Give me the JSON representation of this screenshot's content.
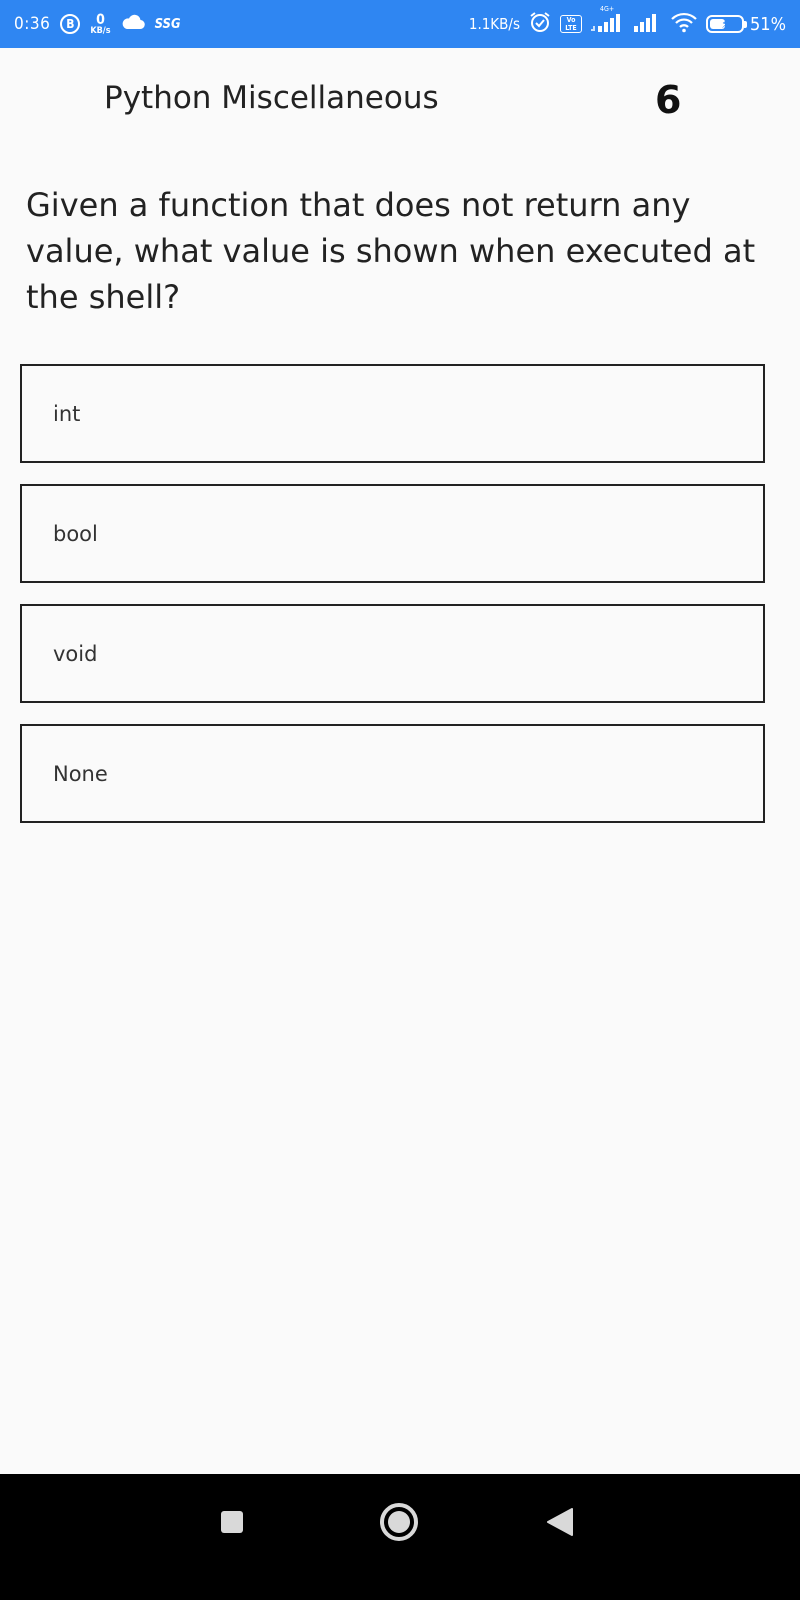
{
  "status_bar": {
    "time": "0:36",
    "b_badge": "B",
    "net_kbs_value": "0",
    "net_kbs_unit": "KB/s",
    "carrier_tag": "SSG",
    "speed": "1.1KB/s",
    "volte_top": "Vo",
    "volte_bottom": "LTE",
    "network_type": "4G+",
    "battery_percent": "51%",
    "battery_level": 0.51,
    "icons": [
      "cloud-icon",
      "alarm-icon",
      "signal-icon",
      "signal-icon",
      "wifi-icon",
      "battery-charging-icon"
    ]
  },
  "header": {
    "title": "Python Miscellaneous",
    "question_number": "6"
  },
  "question": {
    "text": "Given a function that does not return any value, what value is shown when executed at the shell?"
  },
  "options": [
    {
      "label": "int"
    },
    {
      "label": "bool"
    },
    {
      "label": "void"
    },
    {
      "label": "None"
    }
  ],
  "nav_bar": {
    "icons": [
      "recents-icon",
      "home-icon",
      "back-icon"
    ]
  },
  "colors": {
    "status_bar": "#2f86f2",
    "background": "#fafafa",
    "option_border": "#222222",
    "nav_bar": "#000000"
  }
}
